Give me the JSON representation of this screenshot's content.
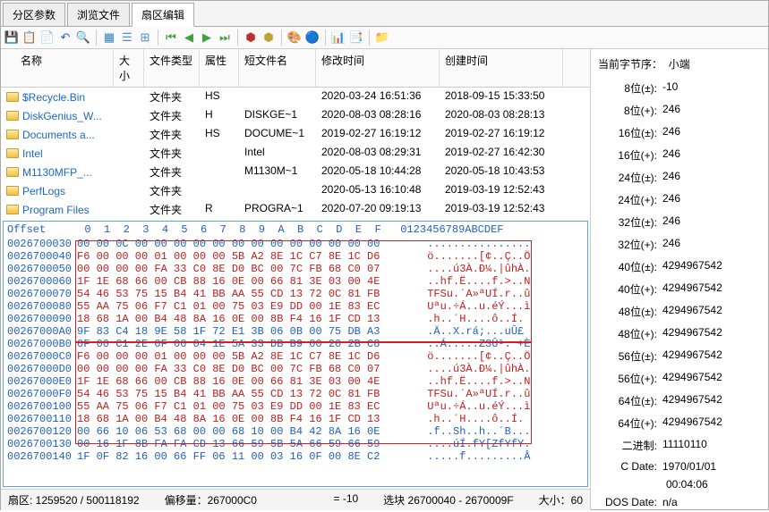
{
  "tabs": [
    {
      "label": "分区参数"
    },
    {
      "label": "浏览文件"
    },
    {
      "label": "扇区编辑"
    }
  ],
  "filecols": {
    "name": "名称",
    "size": "大小",
    "type": "文件类型",
    "attr": "属性",
    "short": "短文件名",
    "modify": "修改时间",
    "create": "创建时间"
  },
  "files": [
    {
      "name": "$Recycle.Bin",
      "type": "文件夹",
      "attr": "HS",
      "short": "",
      "modify": "2020-03-24 16:51:36",
      "create": "2018-09-15 15:33:50"
    },
    {
      "name": "DiskGenius_W...",
      "type": "文件夹",
      "attr": "H",
      "short": "DISKGE~1",
      "modify": "2020-08-03 08:28:16",
      "create": "2020-08-03 08:28:13"
    },
    {
      "name": "Documents a...",
      "type": "文件夹",
      "attr": "HS",
      "short": "DOCUME~1",
      "modify": "2019-02-27 16:19:12",
      "create": "2019-02-27 16:19:12"
    },
    {
      "name": "Intel",
      "type": "文件夹",
      "attr": "",
      "short": "Intel",
      "modify": "2020-08-03 08:29:31",
      "create": "2019-02-27 16:42:30"
    },
    {
      "name": "M1130MFP_...",
      "type": "文件夹",
      "attr": "",
      "short": "M1130M~1",
      "modify": "2020-05-18 10:44:28",
      "create": "2020-05-18 10:43:53"
    },
    {
      "name": "PerfLogs",
      "type": "文件夹",
      "attr": "",
      "short": "",
      "modify": "2020-05-13 16:10:48",
      "create": "2019-03-19 12:52:43"
    },
    {
      "name": "Program Files",
      "type": "文件夹",
      "attr": "R",
      "short": "PROGRA~1",
      "modify": "2020-07-20 09:19:13",
      "create": "2019-03-19 12:52:43"
    }
  ],
  "hexHeader": "Offset      0  1  2  3  4  5  6  7  8  9  A  B  C  D  E  F   0123456789ABCDEF",
  "hex": [
    {
      "off": "0026700030",
      "hex": "00 00 0C 00 00 00 00 00 00 00 00 00 00 00 00 00",
      "asc": "................"
    },
    {
      "off": "0026700040",
      "hex": "F6 00 00 00 01 00 00 00 5B A2 8E 1C C7 8E 1C D6",
      "asc": "ö.......[¢..Ç..Ö",
      "r": 1
    },
    {
      "off": "0026700050",
      "hex": "00 00 00 00 FA 33 C0 8E D0 BC 00 7C FB 68 C0 07",
      "asc": "....ú3À.Ð¼.|ûhÀ.",
      "r": 1
    },
    {
      "off": "0026700060",
      "hex": "1F 1E 68 66 00 CB 88 16 0E 00 66 81 3E 03 00 4E",
      "asc": "..hf.Ë....f.>..N",
      "r": 1
    },
    {
      "off": "0026700070",
      "hex": "54 46 53 75 15 B4 41 BB AA 55 CD 13 72 0C 81 FB",
      "asc": "TFSu.´A»ªUÍ.r..û",
      "r": 1
    },
    {
      "off": "0026700080",
      "hex": "55 AA 75 06 F7 C1 01 00 75 03 E9 DD 00 1E 83 EC",
      "asc": "Uªu.÷Á..u.éÝ...ì",
      "r": 1
    },
    {
      "off": "0026700090",
      "hex": "18 68 1A 00 B4 48 8A 16 0E 00 8B F4 16 1F CD 13",
      "asc": ".h..´H....ô..Í.",
      "r": 1
    },
    {
      "off": "00267000A0",
      "hex": "9F 83 C4 18 9E 58 1F 72 E1 3B 06 0B 00 75 DB A3",
      "asc": ".Ä..X.rá;...uÛ£"
    },
    {
      "off": "00267000B0",
      "hex": "0F 00 C1 2E 0F 00 04 1E 5A 33 DB B9 00 20 2B C8",
      "asc": "..Á.....Z3Û¹. +È"
    },
    {
      "off": "00267000C0",
      "hex": "F6 00 00 00 01 00 00 00 5B A2 8E 1C C7 8E 1C D6",
      "asc": "ö.......[¢..Ç..Ö",
      "r": 1
    },
    {
      "off": "00267000D0",
      "hex": "00 00 00 00 FA 33 C0 8E D0 BC 00 7C FB 68 C0 07",
      "asc": "....ú3À.Ð¼.|ûhÀ.",
      "r": 1
    },
    {
      "off": "00267000E0",
      "hex": "1F 1E 68 66 00 CB 88 16 0E 00 66 81 3E 03 00 4E",
      "asc": "..hf.Ë....f.>..N",
      "r": 1
    },
    {
      "off": "00267000F0",
      "hex": "54 46 53 75 15 B4 41 BB AA 55 CD 13 72 0C 81 FB",
      "asc": "TFSu.´A»ªUÍ.r..û",
      "r": 1
    },
    {
      "off": "0026700100",
      "hex": "55 AA 75 06 F7 C1 01 00 75 03 E9 DD 00 1E 83 EC",
      "asc": "Uªu.÷Á..u.éÝ...ì",
      "r": 1
    },
    {
      "off": "0026700110",
      "hex": "18 68 1A 00 B4 48 8A 16 0E 00 8B F4 16 1F CD 13",
      "asc": ".h..´H....ô..Í.",
      "r": 1
    },
    {
      "off": "0026700120",
      "hex": "00 66 10 06 53 68 00 00 68 10 00 B4 42 8A 16 0E",
      "asc": ".f..Sh..h..´B..."
    },
    {
      "off": "0026700130",
      "hex": "00 16 1F 8B FA FA CD 13 66 59 5B 5A 66 59 66 59",
      "asc": "....úÍ.fY[ZfYfY."
    },
    {
      "off": "0026700140",
      "hex": "1F 0F 82 16 00 66 FF 06 11 00 03 16 0F 00 8E C2",
      "asc": ".....f.........Â"
    }
  ],
  "right": {
    "title1": "当前字节序：",
    "title2": "小端",
    "rows": [
      {
        "lbl": "8位(±):",
        "val": "-10"
      },
      {
        "lbl": "8位(+):",
        "val": "246"
      },
      {
        "lbl": "16位(±):",
        "val": "246"
      },
      {
        "lbl": "16位(+):",
        "val": "246"
      },
      {
        "lbl": "24位(±):",
        "val": "246"
      },
      {
        "lbl": "24位(+):",
        "val": "246"
      },
      {
        "lbl": "32位(±):",
        "val": "246"
      },
      {
        "lbl": "32位(+):",
        "val": "246"
      },
      {
        "lbl": "40位(±):",
        "val": "4294967542"
      },
      {
        "lbl": "40位(+):",
        "val": "4294967542"
      },
      {
        "lbl": "48位(±):",
        "val": "4294967542"
      },
      {
        "lbl": "48位(+):",
        "val": "4294967542"
      },
      {
        "lbl": "56位(±):",
        "val": "4294967542"
      },
      {
        "lbl": "56位(+):",
        "val": "4294967542"
      },
      {
        "lbl": "64位(±):",
        "val": "4294967542"
      },
      {
        "lbl": "64位(+):",
        "val": "4294967542"
      },
      {
        "lbl": "二进制:",
        "val": "11110110"
      },
      {
        "lbl": "C Date:",
        "val": "1970/01/01"
      }
    ],
    "cdate2": "00:04:06",
    "dosdate_lbl": "DOS Date:",
    "dosdate_val": "n/a"
  },
  "status": {
    "sector_lbl": "扇区: ",
    "sector_val": "1259520 / 500118192",
    "offset_lbl": "偏移量：",
    "offset_val": "267000C0",
    "eq": "= -10",
    "sel_lbl": "选块 ",
    "sel_val": "26700040 - 2670009F",
    "size_lbl": "大小：",
    "size_val": "60"
  }
}
